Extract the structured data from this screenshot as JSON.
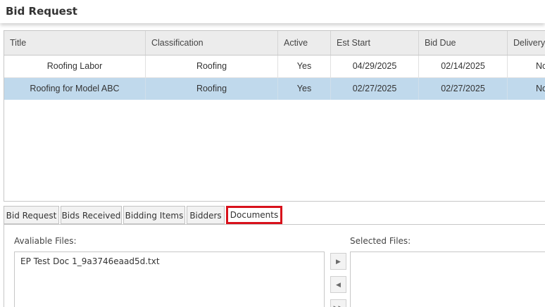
{
  "header": {
    "title": "Bid Request"
  },
  "grid": {
    "columns": [
      "Title",
      "Classification",
      "Active",
      "Est Start",
      "Bid Due",
      "Delivery"
    ],
    "rows": [
      {
        "title": "Roofing Labor",
        "classification": "Roofing",
        "active": "Yes",
        "est_start": "04/29/2025",
        "bid_due": "02/14/2025",
        "delivery": "No"
      },
      {
        "title": "Roofing for Model ABC",
        "classification": "Roofing",
        "active": "Yes",
        "est_start": "02/27/2025",
        "bid_due": "02/27/2025",
        "delivery": "No"
      }
    ],
    "selected_row": 1
  },
  "tabs": [
    {
      "label": "Bid Request"
    },
    {
      "label": "Bids Received"
    },
    {
      "label": "Bidding Items"
    },
    {
      "label": "Bidders"
    },
    {
      "label": "Documents",
      "active": true
    }
  ],
  "documents": {
    "available_label": "Avaliable Files:",
    "selected_label": "Selected Files:",
    "available_files": [
      "EP Test Doc 1_9a3746eaad5d.txt"
    ],
    "selected_files": [],
    "buttons": [
      {
        "icon": "move-right-icon",
        "glyph": "▶"
      },
      {
        "icon": "move-left-icon",
        "glyph": "◀"
      },
      {
        "icon": "move-all-right-icon",
        "glyph": "▶▶"
      }
    ]
  },
  "colors": {
    "selected_row": "#c0d9ec",
    "header_bg": "#ececec",
    "active_tab_highlight": "#d8111b"
  }
}
